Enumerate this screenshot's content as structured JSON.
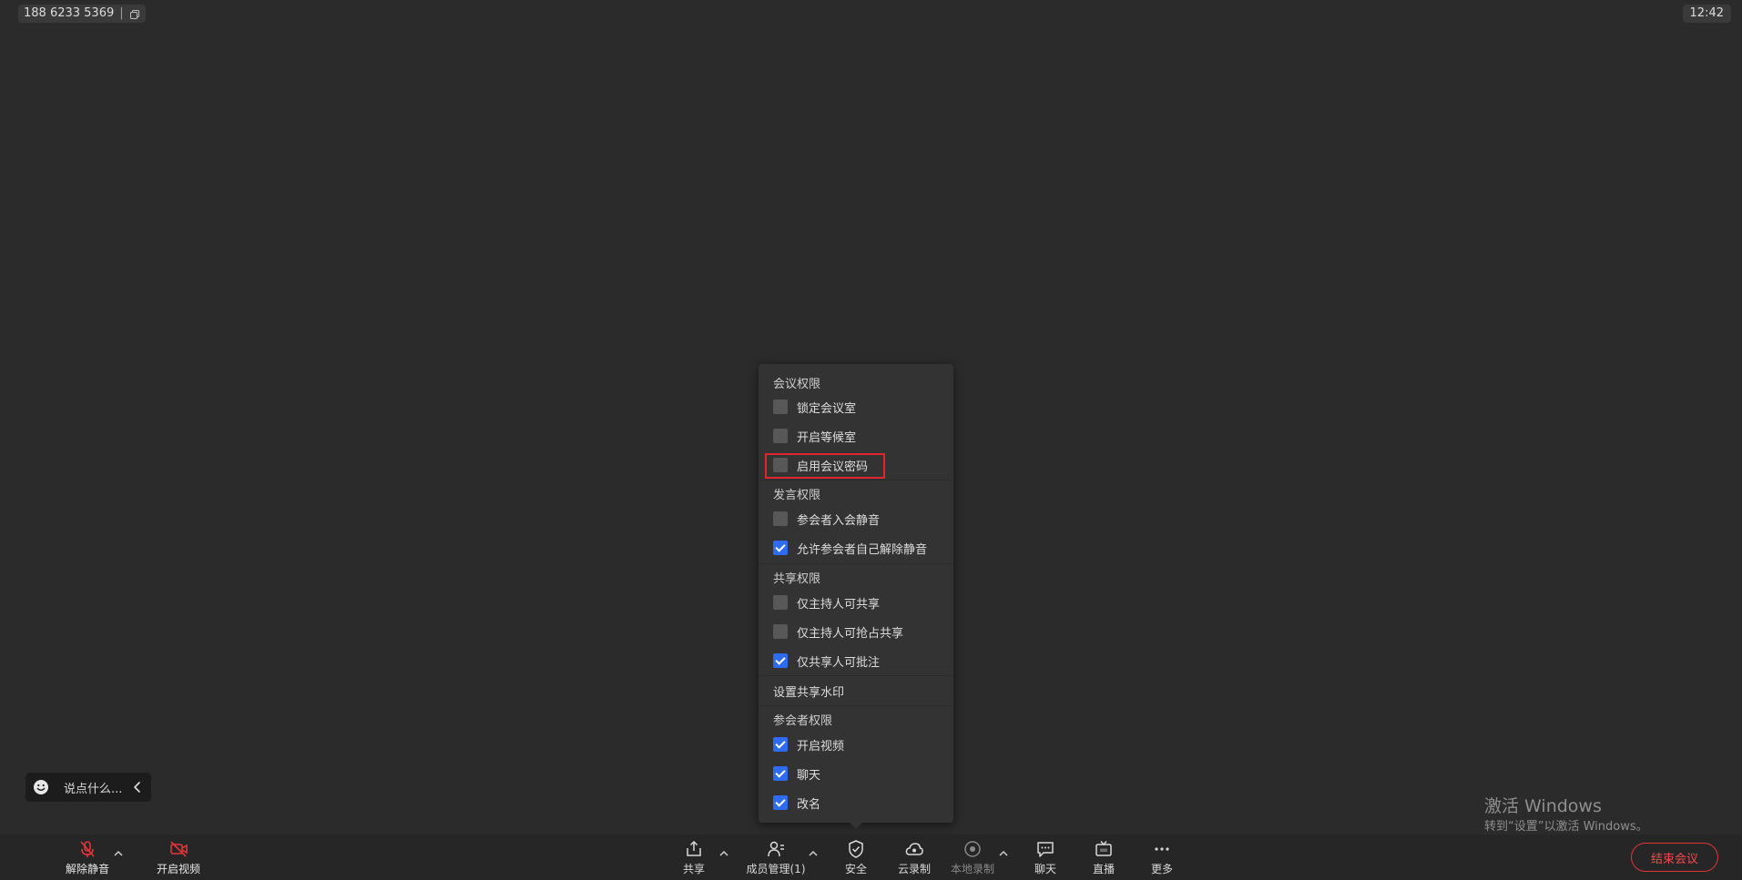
{
  "topbar": {
    "meeting_id": "188 6233 5369",
    "separator": "|",
    "time": "12:42"
  },
  "chat": {
    "placeholder": "说点什么..."
  },
  "popup": {
    "sections": {
      "meeting": "会议权限",
      "speaking": "发言权限",
      "sharing": "共享权限",
      "participants": "参会者权限"
    },
    "items": {
      "lock_room": {
        "label": "锁定会议室",
        "checked": false
      },
      "waiting_room": {
        "label": "开启等候室",
        "checked": false
      },
      "meeting_password": {
        "label": "启用会议密码",
        "checked": false
      },
      "mute_on_entry": {
        "label": "参会者入会静音",
        "checked": false
      },
      "allow_self_unmute": {
        "label": "允许参会者自己解除静音",
        "checked": true
      },
      "host_only_share": {
        "label": "仅主持人可共享",
        "checked": false
      },
      "host_grab_share": {
        "label": "仅主持人可抢占共享",
        "checked": false
      },
      "sharer_annotate": {
        "label": "仅共享人可批注",
        "checked": true
      },
      "share_watermark": {
        "label": "设置共享水印"
      },
      "enable_video": {
        "label": "开启视频",
        "checked": true
      },
      "chat": {
        "label": "聊天",
        "checked": true
      },
      "rename": {
        "label": "改名",
        "checked": true
      }
    }
  },
  "toolbar": {
    "unmute": "解除静音",
    "start_video": "开启视频",
    "share": "共享",
    "members": "成员管理(1)",
    "security": "安全",
    "cloud_record": "云录制",
    "local_record": "本地录制",
    "chat": "聊天",
    "live": "直播",
    "more": "更多",
    "end_meeting": "结束会议"
  },
  "watermark": {
    "line1": "激活 Windows",
    "line2": "转到“设置”以激活 Windows。"
  },
  "colors": {
    "background": "#2b2b2b",
    "checkbox_checked": "#2f6bf1",
    "highlight": "#e0262b",
    "end_button": "#e0363a",
    "muted_icon": "#e0363a"
  }
}
